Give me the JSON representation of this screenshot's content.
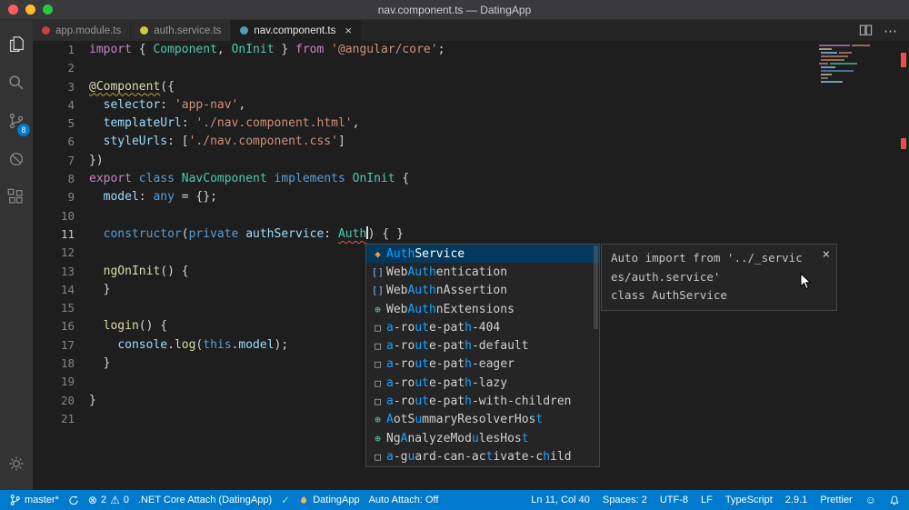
{
  "colors": {
    "statusbar": "#007ACC",
    "editor_bg": "#1E1E1E",
    "panel_bg": "#252526",
    "activitybar_bg": "#333333",
    "titlebar_bg": "#3A3A3C",
    "tab_inactive_bg": "#2D2D2D",
    "selection_bg": "#04395E",
    "match_hl": "#18A3FF",
    "error": "#F14C4C",
    "tok_keyword": "#C586C0",
    "tok_type": "#4EC9B0",
    "tok_string": "#CE9178",
    "tok_storage": "#569CD6",
    "tok_var": "#9CDCFE",
    "tok_fn": "#DCDCAA",
    "tok_plain": "#D4D4D4"
  },
  "window": {
    "title": "nav.component.ts — DatingApp"
  },
  "activity_bar": {
    "scm_badge": "8"
  },
  "icons": {
    "error": "⊗",
    "warning": "⚠",
    "check": "✓",
    "feedback": "☺",
    "more": "⋯",
    "close": "×"
  },
  "tabs": [
    {
      "label": "app.module.ts",
      "color": "#CC3E44",
      "active": false
    },
    {
      "label": "auth.service.ts",
      "color": "#CBCB41",
      "active": false
    },
    {
      "label": "nav.component.ts",
      "color": "#519ABA",
      "active": true,
      "close": "×"
    }
  ],
  "editor": {
    "lines": [
      {
        "n": "1",
        "t": [
          [
            "kw",
            "import"
          ],
          [
            "pl",
            " { "
          ],
          [
            "ty",
            "Component"
          ],
          [
            "pl",
            ", "
          ],
          [
            "ty",
            "OnInit"
          ],
          [
            "pl",
            " } "
          ],
          [
            "kw",
            "from"
          ],
          [
            "pl",
            " "
          ],
          [
            "st",
            "'@angular/core'"
          ],
          [
            "pl",
            ";"
          ]
        ]
      },
      {
        "n": "2",
        "t": []
      },
      {
        "n": "3",
        "t": [
          [
            "dec",
            "@Component"
          ],
          [
            "pl",
            "({"
          ]
        ]
      },
      {
        "n": "4",
        "t": [
          [
            "pl",
            "  "
          ],
          [
            "va",
            "selector"
          ],
          [
            "pl",
            ": "
          ],
          [
            "st",
            "'app-nav'"
          ],
          [
            "pl",
            ","
          ]
        ]
      },
      {
        "n": "5",
        "t": [
          [
            "pl",
            "  "
          ],
          [
            "va",
            "templateUrl"
          ],
          [
            "pl",
            ": "
          ],
          [
            "st",
            "'./nav.component.html'"
          ],
          [
            "pl",
            ","
          ]
        ]
      },
      {
        "n": "6",
        "t": [
          [
            "pl",
            "  "
          ],
          [
            "va",
            "styleUrls"
          ],
          [
            "pl",
            ": ["
          ],
          [
            "st",
            "'./nav.component.css'"
          ],
          [
            "pl",
            "]"
          ]
        ]
      },
      {
        "n": "7",
        "t": [
          [
            "pl",
            "})"
          ]
        ]
      },
      {
        "n": "8",
        "t": [
          [
            "kw",
            "export"
          ],
          [
            "pl",
            " "
          ],
          [
            "sb",
            "class"
          ],
          [
            "pl",
            " "
          ],
          [
            "ty",
            "NavComponent"
          ],
          [
            "pl",
            " "
          ],
          [
            "sb",
            "implements"
          ],
          [
            "pl",
            " "
          ],
          [
            "ty",
            "OnInit"
          ],
          [
            "pl",
            " {"
          ]
        ]
      },
      {
        "n": "9",
        "t": [
          [
            "pl",
            "  "
          ],
          [
            "va",
            "model"
          ],
          [
            "pl",
            ": "
          ],
          [
            "sb",
            "any"
          ],
          [
            "pl",
            " = {};"
          ]
        ]
      },
      {
        "n": "10",
        "t": []
      },
      {
        "n": "11",
        "active": true,
        "t": [
          [
            "pl",
            "  "
          ],
          [
            "sb",
            "constructor"
          ],
          [
            "pl",
            "("
          ],
          [
            "sb",
            "private"
          ],
          [
            "pl",
            " "
          ],
          [
            "va",
            "authService"
          ],
          [
            "pl",
            ": "
          ],
          [
            "er",
            "Auth"
          ],
          [
            "caret",
            ""
          ],
          [
            "pl",
            ") { }"
          ]
        ]
      },
      {
        "n": "12",
        "t": []
      },
      {
        "n": "13",
        "t": [
          [
            "pl",
            "  "
          ],
          [
            "fn",
            "ngOnInit"
          ],
          [
            "pl",
            "() {"
          ]
        ]
      },
      {
        "n": "14",
        "t": [
          [
            "pl",
            "  }"
          ]
        ]
      },
      {
        "n": "15",
        "t": []
      },
      {
        "n": "16",
        "t": [
          [
            "pl",
            "  "
          ],
          [
            "fn",
            "login"
          ],
          [
            "pl",
            "() {"
          ]
        ]
      },
      {
        "n": "17",
        "t": [
          [
            "pl",
            "    "
          ],
          [
            "va",
            "console"
          ],
          [
            "pl",
            "."
          ],
          [
            "fn",
            "log"
          ],
          [
            "pl",
            "("
          ],
          [
            "sb",
            "this"
          ],
          [
            "pl",
            "."
          ],
          [
            "va",
            "model"
          ],
          [
            "pl",
            ");"
          ]
        ]
      },
      {
        "n": "18",
        "t": [
          [
            "pl",
            "  }"
          ]
        ]
      },
      {
        "n": "19",
        "t": []
      },
      {
        "n": "20",
        "t": [
          [
            "pl",
            "}"
          ]
        ]
      },
      {
        "n": "21",
        "t": []
      }
    ]
  },
  "suggest": {
    "icon_glyphs": {
      "class": "◆",
      "brackets": "[]",
      "interface": "⊕",
      "snippet": "□"
    },
    "icon_colors": {
      "class": "#EE9D28",
      "brackets": "#75BEFF",
      "interface": "#4EC9B0",
      "snippet": "#C5C5C5"
    },
    "items": [
      {
        "icon": "class",
        "sel": true,
        "segs": [
          [
            "Auth",
            1
          ],
          [
            "Service",
            0
          ]
        ]
      },
      {
        "icon": "brackets",
        "segs": [
          [
            "Web",
            0
          ],
          [
            "Auth",
            1
          ],
          [
            "entication",
            0
          ]
        ]
      },
      {
        "icon": "brackets",
        "segs": [
          [
            "Web",
            0
          ],
          [
            "Auth",
            1
          ],
          [
            "nAssertion",
            0
          ]
        ]
      },
      {
        "icon": "interface",
        "segs": [
          [
            "Web",
            0
          ],
          [
            "Auth",
            1
          ],
          [
            "nExtensions",
            0
          ]
        ]
      },
      {
        "icon": "snippet",
        "segs": [
          [
            "a",
            1
          ],
          [
            "-ro",
            0
          ],
          [
            "ut",
            1
          ],
          [
            "e-pat",
            0
          ],
          [
            "h",
            1
          ],
          [
            "-404",
            0
          ]
        ]
      },
      {
        "icon": "snippet",
        "segs": [
          [
            "a",
            1
          ],
          [
            "-ro",
            0
          ],
          [
            "ut",
            1
          ],
          [
            "e-pat",
            0
          ],
          [
            "h",
            1
          ],
          [
            "-default",
            0
          ]
        ]
      },
      {
        "icon": "snippet",
        "segs": [
          [
            "a",
            1
          ],
          [
            "-ro",
            0
          ],
          [
            "ut",
            1
          ],
          [
            "e-pat",
            0
          ],
          [
            "h",
            1
          ],
          [
            "-eager",
            0
          ]
        ]
      },
      {
        "icon": "snippet",
        "segs": [
          [
            "a",
            1
          ],
          [
            "-ro",
            0
          ],
          [
            "ut",
            1
          ],
          [
            "e-pat",
            0
          ],
          [
            "h",
            1
          ],
          [
            "-lazy",
            0
          ]
        ]
      },
      {
        "icon": "snippet",
        "segs": [
          [
            "a",
            1
          ],
          [
            "-ro",
            0
          ],
          [
            "ut",
            1
          ],
          [
            "e-pat",
            0
          ],
          [
            "h",
            1
          ],
          [
            "-with-children",
            0
          ]
        ]
      },
      {
        "icon": "interface",
        "segs": [
          [
            "A",
            1
          ],
          [
            "otS",
            0
          ],
          [
            "u",
            1
          ],
          [
            "mmaryResolverHos",
            0
          ],
          [
            "t",
            1
          ]
        ]
      },
      {
        "icon": "interface",
        "segs": [
          [
            "Ng",
            0
          ],
          [
            "A",
            1
          ],
          [
            "nalyzeMod",
            0
          ],
          [
            "u",
            1
          ],
          [
            "lesHos",
            0
          ],
          [
            "t",
            1
          ]
        ]
      },
      {
        "icon": "snippet",
        "segs": [
          [
            "a",
            1
          ],
          [
            "-g",
            0
          ],
          [
            "u",
            1
          ],
          [
            "ard-can-ac",
            0
          ],
          [
            "t",
            1
          ],
          [
            "ivate-c",
            0
          ],
          [
            "h",
            1
          ],
          [
            "ild",
            0
          ]
        ]
      }
    ]
  },
  "doc": {
    "lines": [
      "Auto import from '../_servic",
      "es/auth.service'",
      "class AuthService"
    ],
    "close": "×"
  },
  "status": {
    "branch": "master*",
    "errors": "2",
    "warnings": "0",
    "debug_target": ".NET Core Attach (DatingApp)",
    "task": "DatingApp",
    "auto_attach": "Auto Attach: Off",
    "cursor": "Ln 11, Col 40",
    "indent": "Spaces: 2",
    "encoding": "UTF-8",
    "eol": "LF",
    "language": "TypeScript",
    "ts_version": "2.9.1",
    "formatter": "Prettier"
  }
}
